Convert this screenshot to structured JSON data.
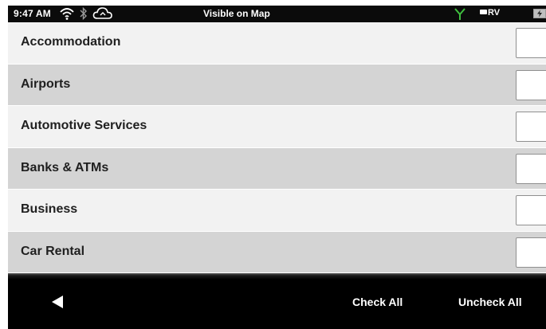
{
  "status_bar": {
    "time": "9:47 AM",
    "title": "Visible on Map",
    "rv_label": "RV",
    "icons": [
      "wifi-icon",
      "bluetooth-icon",
      "cloud-icon",
      "gps-antenna-icon",
      "battery-charging-icon"
    ],
    "gps_color": "#3fbf3f"
  },
  "categories": [
    {
      "label": "Accommodation",
      "checked": false
    },
    {
      "label": "Airports",
      "checked": false
    },
    {
      "label": "Automotive Services",
      "checked": false
    },
    {
      "label": "Banks & ATMs",
      "checked": false
    },
    {
      "label": "Business",
      "checked": false
    },
    {
      "label": "Car Rental",
      "checked": false
    }
  ],
  "bottom_bar": {
    "back_icon": "back-arrow-icon",
    "check_all_label": "Check All",
    "uncheck_all_label": "Uncheck All"
  },
  "colors": {
    "row_light": "#f2f2f2",
    "row_dark": "#d4d4d4",
    "bar_background": "#000000"
  }
}
